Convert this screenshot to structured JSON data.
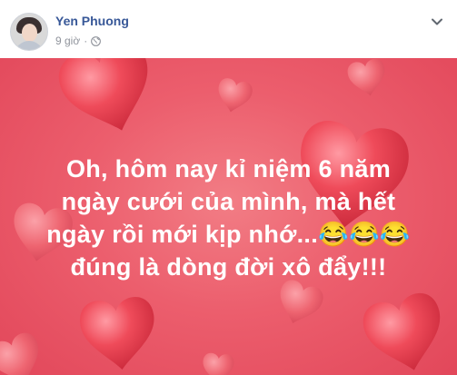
{
  "post": {
    "author_name": "Yen Phuong",
    "timestamp": "9 giờ",
    "separator": "·",
    "privacy_icon": "globe-icon",
    "menu_icon": "chevron-down-icon",
    "avatar_icon": "avatar"
  },
  "media": {
    "background_color": "#ec5e6d",
    "text_lines": [
      "Oh, hôm nay kỉ niệm 6 năm",
      "ngày cưới của mình, mà hết",
      "ngày rồi mới kịp nhớ...😂😂😂",
      "đúng là dòng đời xô đẩy!!!"
    ]
  },
  "colors": {
    "name_blue": "#385898",
    "meta_gray": "#90949c",
    "heart_red": "#e63446"
  }
}
